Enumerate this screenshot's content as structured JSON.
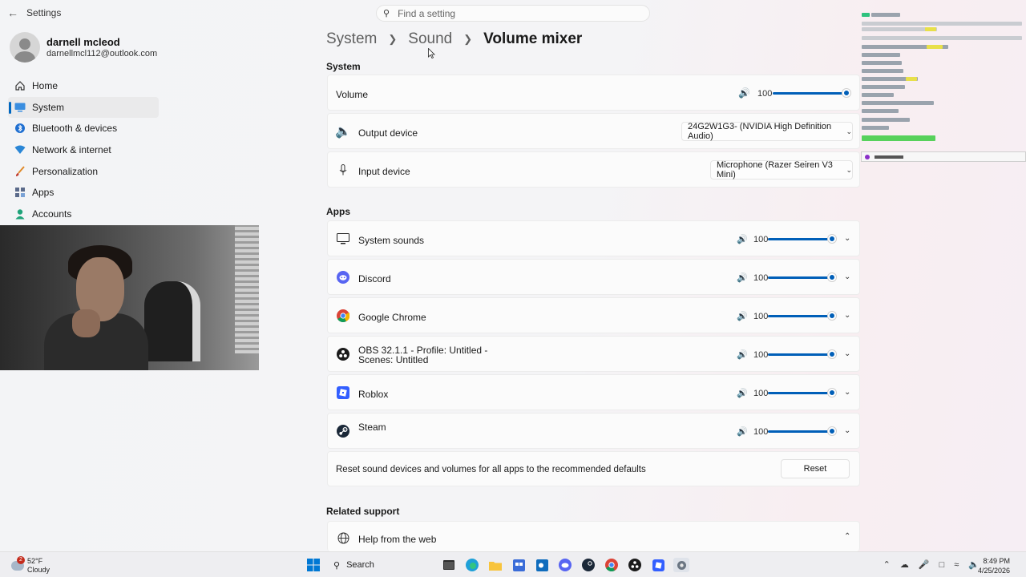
{
  "window": {
    "app_title": "Settings",
    "search_placeholder": "Find a setting"
  },
  "profile": {
    "name": "darnell mcleod",
    "email": "darnellmcl112@outlook.com"
  },
  "nav": {
    "items": [
      {
        "label": "Home",
        "icon": "home-icon"
      },
      {
        "label": "System",
        "icon": "monitor-icon"
      },
      {
        "label": "Bluetooth & devices",
        "icon": "bluetooth-icon"
      },
      {
        "label": "Network & internet",
        "icon": "wifi-icon"
      },
      {
        "label": "Personalization",
        "icon": "brush-icon"
      },
      {
        "label": "Apps",
        "icon": "apps-icon"
      },
      {
        "label": "Accounts",
        "icon": "person-icon"
      }
    ]
  },
  "breadcrumb": {
    "system": "System",
    "sound": "Sound",
    "current": "Volume mixer"
  },
  "system_section": {
    "title": "System",
    "volume_label": "Volume",
    "volume_value": "100",
    "volume_level": 1.0,
    "output_label": "Output device",
    "output_value": "24G2W1G3- (NVIDIA High Definition Audio)",
    "input_label": "Input device",
    "input_value": "Microphone (Razer Seiren V3 Mini)"
  },
  "apps_section": {
    "title": "Apps",
    "apps": [
      {
        "name": "System sounds",
        "volume": "100",
        "level": 1.0,
        "icon": "monitor-icon"
      },
      {
        "name": "Discord",
        "volume": "100",
        "level": 1.0,
        "icon": "discord-icon"
      },
      {
        "name": "Google Chrome",
        "volume": "100",
        "level": 1.0,
        "icon": "chrome-icon"
      },
      {
        "name": "OBS 32.1.1 - Profile: Untitled - Scenes: Untitled",
        "volume": "100",
        "level": 1.0,
        "icon": "obs-icon"
      },
      {
        "name": "Roblox",
        "volume": "100",
        "level": 1.0,
        "icon": "roblox-icon"
      },
      {
        "name": "Steam",
        "volume": "100",
        "level": 1.0,
        "icon": "steam-icon"
      }
    ],
    "reset_text": "Reset sound devices and volumes for all apps to the recommended defaults",
    "reset_button": "Reset"
  },
  "related": {
    "title": "Related support",
    "help_label": "Help from the web"
  },
  "taskbar": {
    "weather_temp": "52°F",
    "weather_desc": "Cloudy",
    "weather_badge": "2",
    "search_label": "Search",
    "time": "8:49 PM",
    "date": "4/25/2026"
  },
  "colors": {
    "accent": "#005fb8",
    "discord": "#5865f2",
    "roblox": "#335fff"
  }
}
